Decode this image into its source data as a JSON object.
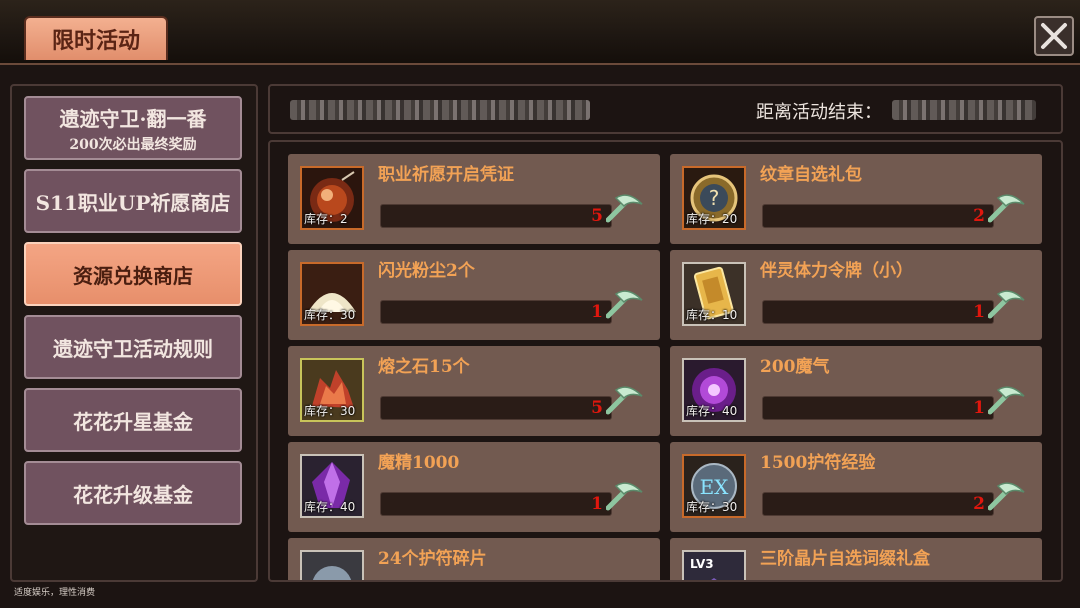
{
  "header": {
    "tab_title": "限时活动"
  },
  "sidebar": {
    "items": [
      {
        "label": "遗迹守卫·翻一番",
        "sublabel": "200次必出最终奖励",
        "active": false
      },
      {
        "label": "S11职业UP祈愿商店",
        "active": false
      },
      {
        "label": "资源兑换商店",
        "active": true
      },
      {
        "label": "遗迹守卫活动规则",
        "active": false
      },
      {
        "label": "花花升星基金",
        "active": false
      },
      {
        "label": "花花升级基金",
        "active": false
      }
    ]
  },
  "infobar": {
    "countdown_label": "距离活动结束："
  },
  "shop": {
    "items": [
      {
        "name": "职业祈愿开启凭证",
        "stock": "库存：2",
        "price": "5",
        "icon": "orb-icon"
      },
      {
        "name": "纹章自选礼包",
        "stock": "库存：20",
        "price": "2",
        "icon": "badge-pack-icon"
      },
      {
        "name": "闪光粉尘2个",
        "stock": "库存：30",
        "price": "1",
        "icon": "dust-pile-icon"
      },
      {
        "name": "伴灵体力令牌（小）",
        "stock": "库存：10",
        "price": "1",
        "icon": "token-icon"
      },
      {
        "name": "熔之石15个",
        "stock": "库存：30",
        "price": "5",
        "icon": "fire-stone-icon"
      },
      {
        "name": "200魔气",
        "stock": "库存：40",
        "price": "1",
        "icon": "magic-orb-icon"
      },
      {
        "name": "魔精1000",
        "stock": "库存：40",
        "price": "1",
        "icon": "purple-crystal-icon"
      },
      {
        "name": "1500护符经验",
        "stock": "库存：30",
        "price": "2",
        "icon": "ex-amulet-icon"
      },
      {
        "name": "24个护符碎片",
        "stock": "",
        "price": "",
        "icon": "amulet-shard-icon"
      },
      {
        "name": "三阶晶片自选词缀礼盒",
        "stock": "",
        "price": "",
        "icon": "lv3-chip-icon",
        "icon_text": "LV3"
      }
    ]
  },
  "footer": {
    "note": "适度娱乐，理性消费"
  },
  "colors": {
    "accent": "#e78f6b",
    "item_name": "#f2a255",
    "price": "#e0170e",
    "button_bg": "#70525f"
  }
}
